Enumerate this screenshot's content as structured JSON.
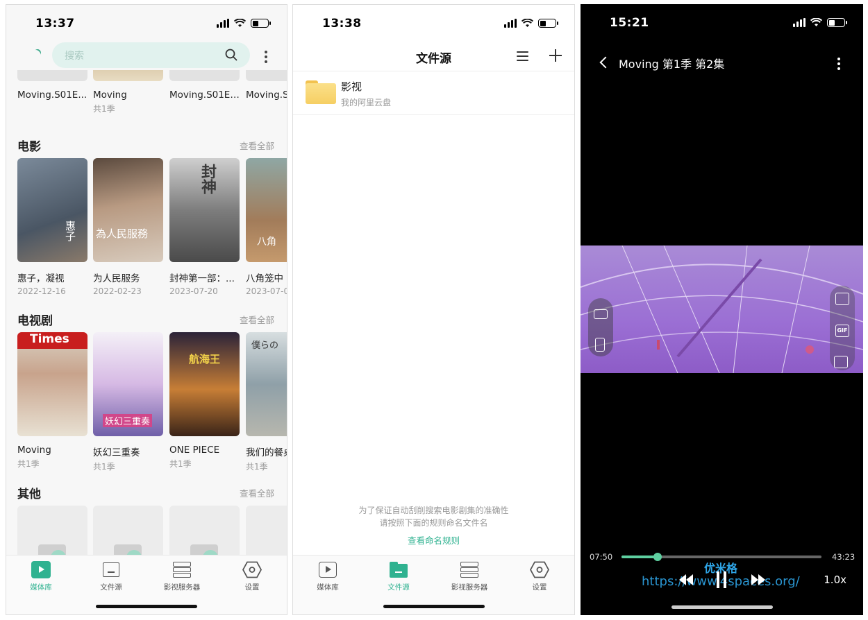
{
  "phone1": {
    "status_time": "13:37",
    "search": {
      "placeholder": "搜索"
    },
    "top_row": [
      {
        "title": "Moving.S01E...",
        "sub": ""
      },
      {
        "title": "Moving",
        "sub": "共1季"
      },
      {
        "title": "Moving.S01E1...",
        "sub": ""
      },
      {
        "title": "Moving.S",
        "sub": ""
      }
    ],
    "movies": {
      "title": "电影",
      "see_all": "查看全部",
      "items": [
        {
          "title": "惠子，凝视",
          "sub": "2022-12-16",
          "poster_text": "惠子"
        },
        {
          "title": "为人民服务",
          "sub": "2022-02-23",
          "poster_text": "為人民服務"
        },
        {
          "title": "封神第一部：...",
          "sub": "2023-07-20",
          "poster_text": "封神"
        },
        {
          "title": "八角笼中",
          "sub": "2023-07-0",
          "poster_text": "八角"
        }
      ]
    },
    "tv": {
      "title": "电视剧",
      "see_all": "查看全部",
      "items": [
        {
          "title": "Moving",
          "sub": "共1季",
          "poster_text": "Times"
        },
        {
          "title": "妖幻三重奏",
          "sub": "共1季",
          "poster_text": "妖幻三重奏"
        },
        {
          "title": "ONE PIECE",
          "sub": "共1季",
          "poster_text": "航海王"
        },
        {
          "title": "我们的餐桌",
          "sub": "共1季",
          "poster_text": "僕らの"
        }
      ]
    },
    "others": {
      "title": "其他",
      "see_all": "查看全部"
    }
  },
  "tabs": [
    {
      "label": "媒体库",
      "icon": "play-square-icon"
    },
    {
      "label": "文件源",
      "icon": "folder-icon"
    },
    {
      "label": "影视服务器",
      "icon": "server-icon"
    },
    {
      "label": "设置",
      "icon": "hexagon-settings-icon"
    }
  ],
  "phone2": {
    "status_time": "13:38",
    "title": "文件源",
    "source": {
      "name": "影视",
      "sub": "我的阿里云盘"
    },
    "hint_line1": "为了保证自动刮削搜索电影剧集的准确性",
    "hint_line2": "请按照下面的规则命名文件名",
    "rule_link": "查看命名规则"
  },
  "phone3": {
    "status_time": "15:21",
    "video_title": "Moving 第1季 第2集",
    "current_time": "07:50",
    "total_time": "43:23",
    "progress": 0.18,
    "speed": "1.0x",
    "watermark_cn": "优米格",
    "watermark_url": "https://www.4spaces.org/"
  },
  "colors": {
    "accent": "#2fb290",
    "player_progress": "#5ecfa0",
    "search_bg": "#e1f2ee"
  }
}
